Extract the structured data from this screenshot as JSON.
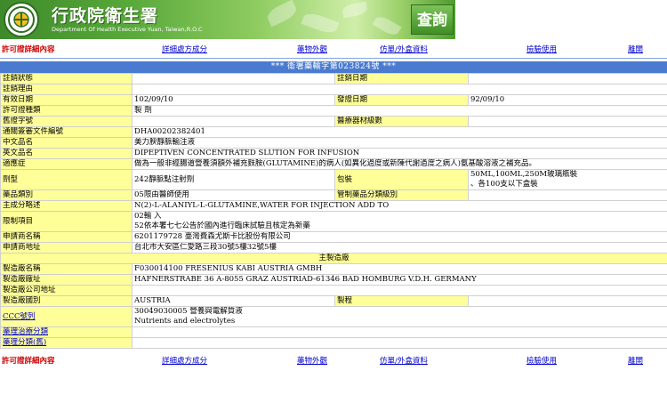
{
  "header": {
    "agency_name_zh": "行政院衛生署",
    "agency_name_en": "Department Of Health Executive Yuan, Taiwan,R.O.C",
    "query_label": "查詢"
  },
  "nav": {
    "title": "許可證詳細內容",
    "links": [
      "詳細處方成分",
      "藥物外觀",
      "仿單/外盒資料",
      "檢驗使用",
      "離開"
    ]
  },
  "license_bar": "*** 衛署藥輸字第023824號 ***",
  "fields": {
    "cancel_status": {
      "label": "註銷狀態",
      "value": ""
    },
    "cancel_date": {
      "label": "註銷日期",
      "value": ""
    },
    "cancel_reason": {
      "label": "註銷理由",
      "value": ""
    },
    "valid_date": {
      "label": "有效日期",
      "value": "102/09/10"
    },
    "issue_date": {
      "label": "發證日期",
      "value": "92/09/10"
    },
    "license_type": {
      "label": "許可證種類",
      "value": "製  劑"
    },
    "old_license": {
      "label": "舊證字號",
      "value": ""
    },
    "device_level": {
      "label": "醫療器材級數",
      "value": ""
    },
    "customs_doc": {
      "label": "通關簽審文件編號",
      "value": "DHA00202382401"
    },
    "name_zh": {
      "label": "中文品名",
      "value": "美力腴靜脈輸注液"
    },
    "name_en": {
      "label": "英文品名",
      "value": "DIPEPTIVEN CONCENTRATED SLUTION FOR INFUSION"
    },
    "indication": {
      "label": "適應症",
      "value": "做為一般非經腸道營養須額外補充麩胺(GLUTAMINE)的病人(如異化過度或新陳代謝過度之病人)氨基酸溶液之補充品。"
    },
    "dosage_form": {
      "label": "劑型",
      "value": "242靜脈點注射劑"
    },
    "package": {
      "label": "包裝",
      "value_line1": "50ML,100ML,250M玻璃瓶裝",
      "value_line2": "、各100支以下盒裝"
    },
    "drug_class": {
      "label": "藥品類別",
      "value": "05限由醫師使用"
    },
    "controlled_class": {
      "label": "管制藥品分類級別",
      "value": ""
    },
    "ingredient_summary": {
      "label": "主成分略述",
      "value": "N(2)-L-ALANIYL-L-GLUTAMINE,WATER FOR INJECTION ADD TO"
    },
    "restriction": {
      "label": "限制項目",
      "value_line1": "02輸  入",
      "value_line2": "52依本署七七公告於國內進行臨床試驗且核定為新藥"
    },
    "applicant_name": {
      "label": "申請商名稱",
      "value": "6201179728 臺灣費森尤斯卡比股份有限公司"
    },
    "applicant_address": {
      "label": "申請商地址",
      "value": "台北市大安區仁愛路三段30號5樓32號5樓"
    },
    "main_manufacturer_header": "主製造廠",
    "mfr_name": {
      "label": "製造廠名稱",
      "value": "F030014100 FRESENIUS KABI AUSTRIA GMBH"
    },
    "mfr_address": {
      "label": "製造廠廠址",
      "value": "HAFNERSTRABE 36 A-8055 GRAZ AUSTRIAD-61346 BAD HOMBURG V.D.H. GERMANY"
    },
    "mfr_company_address": {
      "label": "製造廠公司地址",
      "value": ""
    },
    "mfr_country": {
      "label": "製造廠國別",
      "value": "AUSTRIA"
    },
    "mfr_process": {
      "label": "製程",
      "value": ""
    },
    "ccc_code": {
      "label": "CCC號列",
      "value_line1": "30049030005 營養與電解質液",
      "value_line2": "Nutrients and electrolytes"
    },
    "pharmacology_class": {
      "label": "藥理治療分類",
      "value": ""
    },
    "atc_class": {
      "label": "藥理分類(舊)",
      "value": ""
    }
  }
}
